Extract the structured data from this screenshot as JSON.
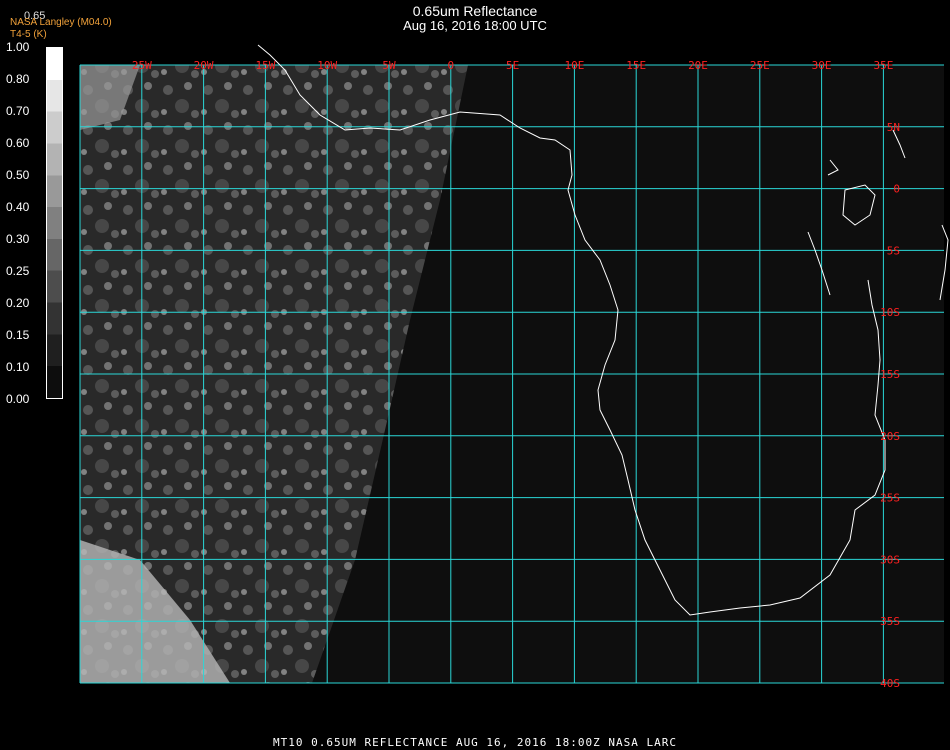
{
  "header": {
    "title": "0.65um Reflectance",
    "datetime": "Aug 16, 2016 18:00 UTC",
    "credit_line1": "NASA Langley (M04.0)",
    "credit_line2": "T4-5 (K)",
    "legend_label": "0.65"
  },
  "colorbar": {
    "ticks": [
      "1.00",
      "0.80",
      "0.70",
      "0.60",
      "0.50",
      "0.40",
      "0.30",
      "0.25",
      "0.20",
      "0.15",
      "0.10",
      "0.00"
    ],
    "colors": [
      "#ffffff",
      "#e6e6e6",
      "#cccccc",
      "#b3b3b3",
      "#999999",
      "#808080",
      "#666666",
      "#4d4d4d",
      "#333333",
      "#1f1f1f",
      "#0d0d0d"
    ]
  },
  "map": {
    "longitude_labels": [
      "25W",
      "20W",
      "15W",
      "10W",
      "5W",
      "0",
      "5E",
      "10E",
      "15E",
      "20E",
      "25E",
      "30E",
      "35E"
    ],
    "latitude_labels": [
      "5N",
      "0",
      "5S",
      "10S",
      "15S",
      "20S",
      "25S",
      "30S",
      "35S",
      "40S"
    ],
    "grid_color": "#2ad7d7",
    "label_color": "#ff2020",
    "coast_color": "#ffffff"
  },
  "footer": {
    "text": "MT10  0.65UM REFLECTANCE   AUG 16, 2016 18:00Z   NASA LARC"
  }
}
